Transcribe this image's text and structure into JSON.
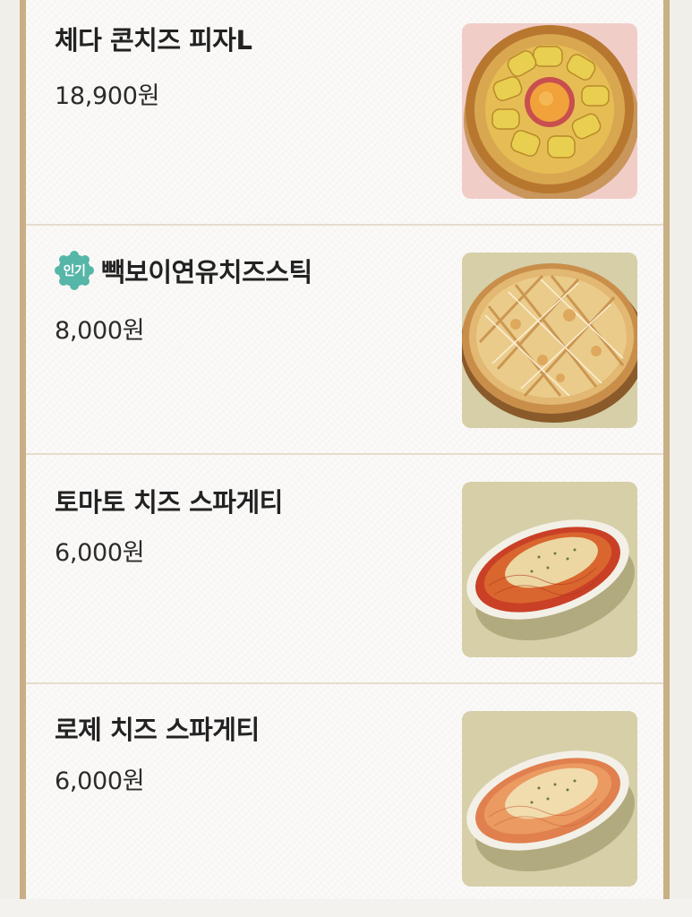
{
  "menu": {
    "items": [
      {
        "name": "체다 콘치즈 피자L",
        "price": "18,900원",
        "badge": "",
        "image": "cheddar-corn-pizza"
      },
      {
        "name": "빽보이연유치즈스틱",
        "price": "8,000원",
        "badge": "인기",
        "image": "condensed-milk-cheese-stick-pizza"
      },
      {
        "name": "토마토 치즈 스파게티",
        "price": "6,000원",
        "badge": "",
        "image": "tomato-cheese-spaghetti"
      },
      {
        "name": "로제 치즈 스파게티",
        "price": "6,000원",
        "badge": "",
        "image": "rose-cheese-spaghetti"
      }
    ]
  },
  "colors": {
    "frame": "#c9ae86",
    "divider": "#e7dccd",
    "badge": "#56b6a8",
    "thumb_pink_bg": "#f1cdc8",
    "thumb_olive_bg": "#d6cfa8"
  }
}
